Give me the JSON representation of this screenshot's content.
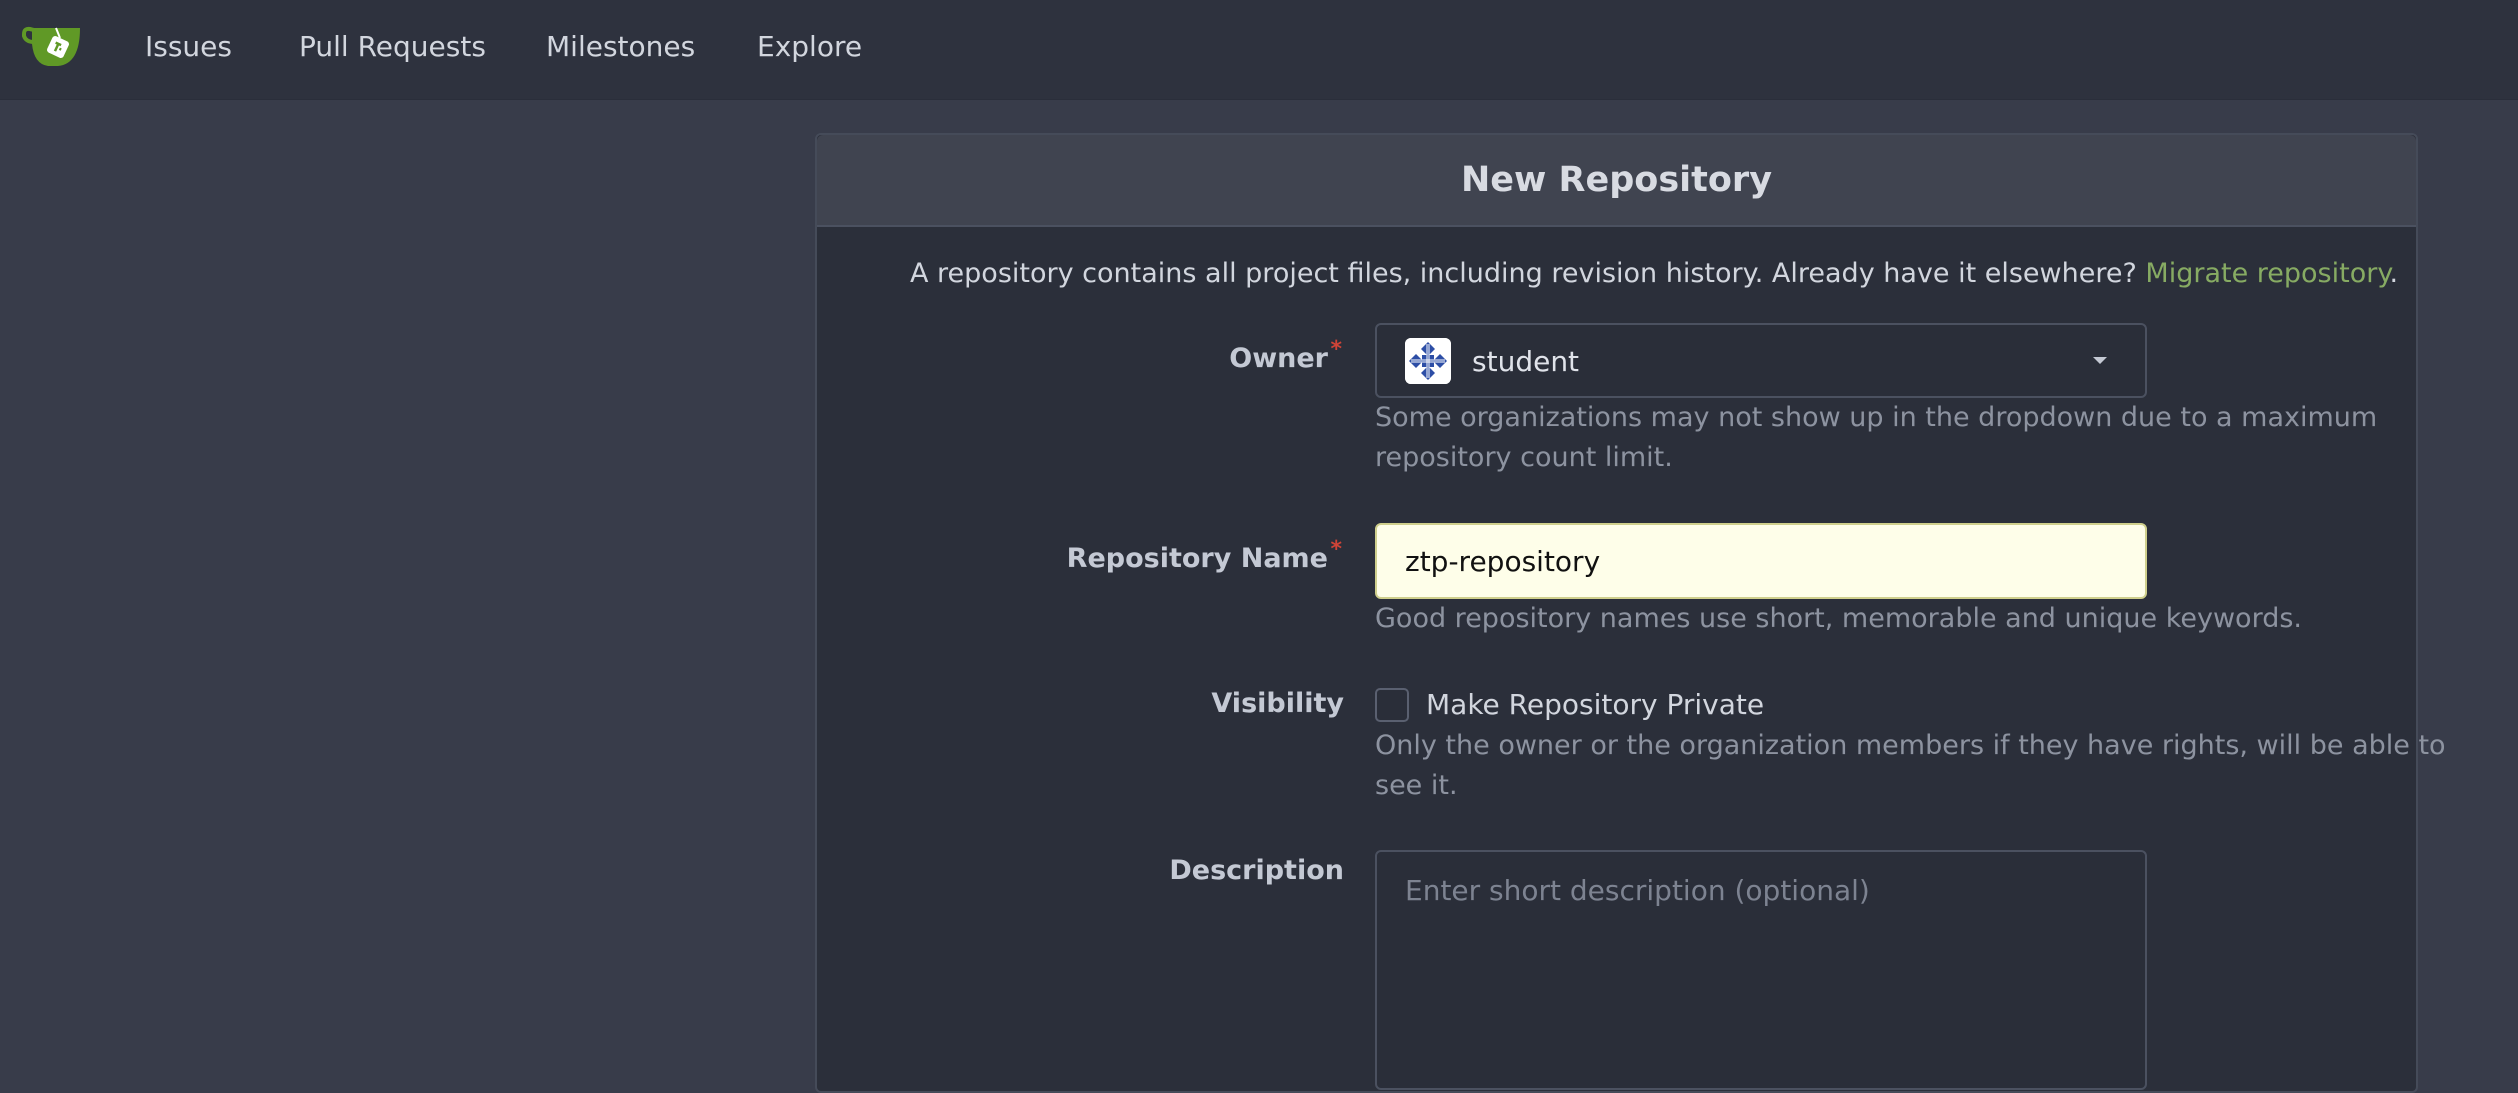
{
  "nav": {
    "logo_icon": "gitea-teacup-logo-icon",
    "items": [
      {
        "label": "Issues"
      },
      {
        "label": "Pull Requests"
      },
      {
        "label": "Milestones"
      },
      {
        "label": "Explore"
      }
    ]
  },
  "panel": {
    "title": "New Repository",
    "intro_text": "A repository contains all project files, including revision history. Already have it elsewhere?",
    "intro_link": "Migrate repository",
    "intro_suffix": "."
  },
  "form": {
    "owner": {
      "label": "Owner",
      "value": "student",
      "avatar_icon": "org-avatar-icon",
      "help_line1": "Some organizations may not show up in the dropdown due to a maximum",
      "help_line2": "repository count limit."
    },
    "repo_name": {
      "label": "Repository Name",
      "value": "ztp-repository",
      "help": "Good repository names use short, memorable and unique keywords."
    },
    "visibility": {
      "label": "Visibility",
      "checkbox_label": "Make Repository Private",
      "checked": false,
      "help_line1": "Only the owner or the organization members if they have rights, will be able to",
      "help_line2": "see it."
    },
    "description": {
      "label": "Description",
      "placeholder": "Enter short description (optional)",
      "value": ""
    }
  },
  "colors": {
    "navbar_bg": "#2e323e",
    "page_bg": "#383c4a",
    "accent_link": "#87ab63",
    "required": "#d04437"
  }
}
